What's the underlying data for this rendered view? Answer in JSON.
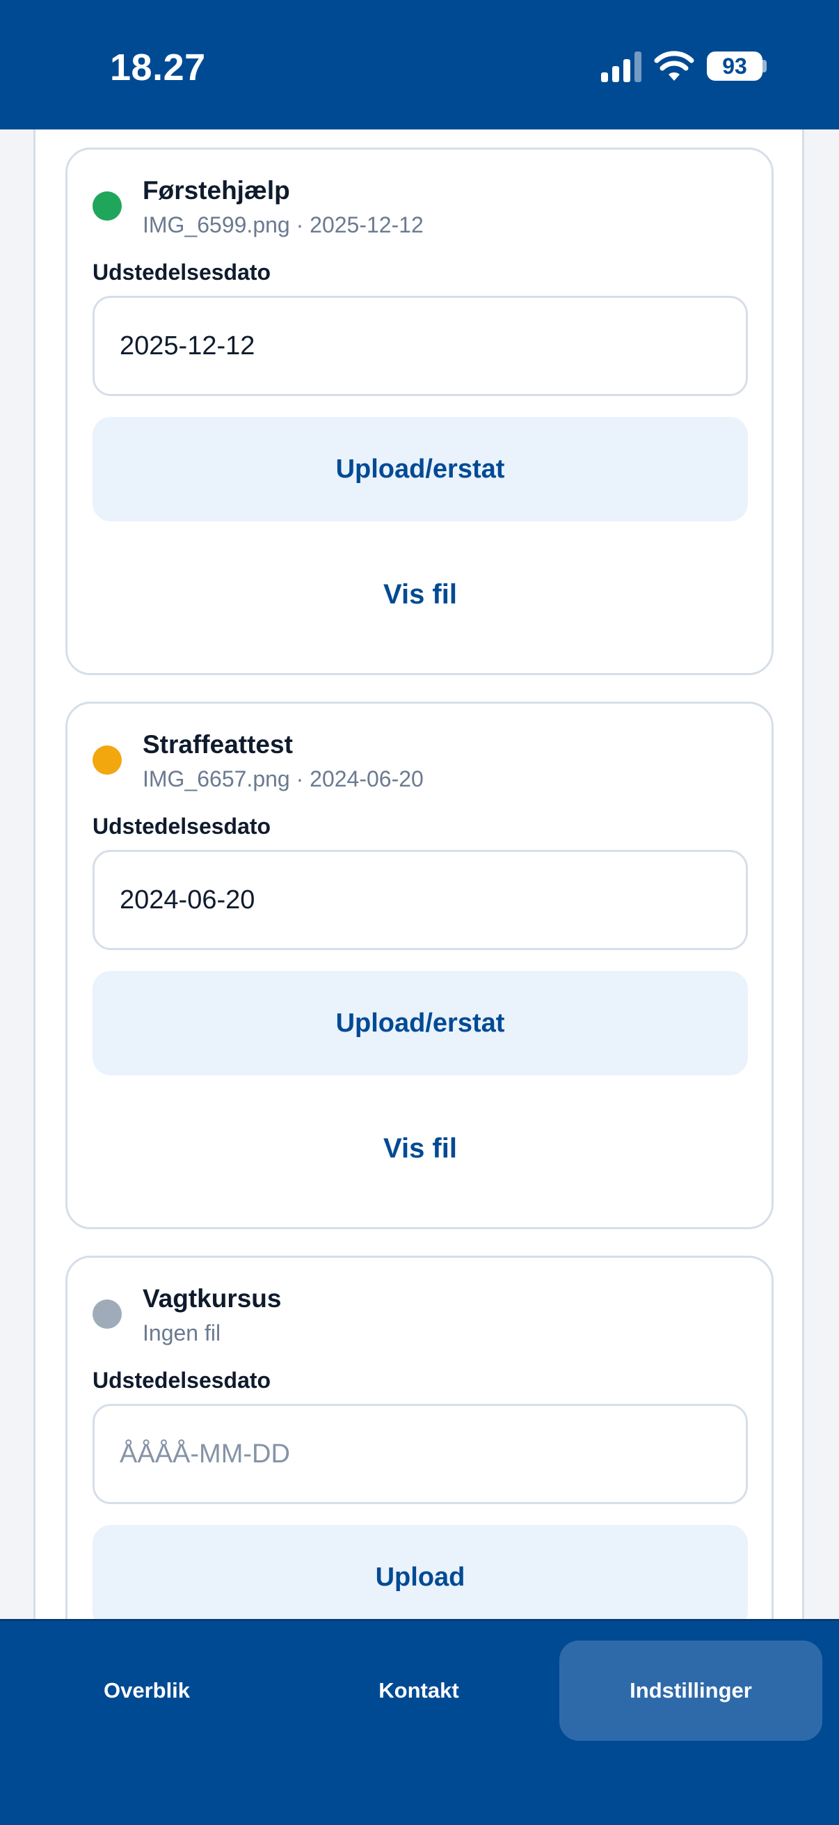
{
  "status_bar": {
    "time": "18.27",
    "battery": "93",
    "icons": [
      "signal-icon",
      "wifi-icon",
      "battery-icon"
    ]
  },
  "documents": [
    {
      "title": "Førstehjælp",
      "meta": "IMG_6599.png · 2025-12-12",
      "status_color": "#1FA65A",
      "date_label": "Udstedelsesdato",
      "date_value": "2025-12-12",
      "date_placeholder": "ÅÅÅÅ-MM-DD",
      "upload_label": "Upload/erstat",
      "view_label": "Vis fil"
    },
    {
      "title": "Straffeattest",
      "meta": "IMG_6657.png · 2024-06-20",
      "status_color": "#F2A70F",
      "date_label": "Udstedelsesdato",
      "date_value": "2024-06-20",
      "date_placeholder": "ÅÅÅÅ-MM-DD",
      "upload_label": "Upload/erstat",
      "view_label": "Vis fil"
    },
    {
      "title": "Vagtkursus",
      "meta": "Ingen fil",
      "status_color": "#A0ABBA",
      "date_label": "Udstedelsesdato",
      "date_value": "",
      "date_placeholder": "ÅÅÅÅ-MM-DD",
      "upload_label": "Upload"
    }
  ],
  "nav": {
    "items": [
      {
        "label": "Overblik",
        "active": false
      },
      {
        "label": "Kontakt",
        "active": false
      },
      {
        "label": "Indstillinger",
        "active": true
      }
    ]
  },
  "colors": {
    "brand": "#004A93",
    "button_bg": "#EAF2FC",
    "border": "#D6DEE9",
    "active_nav": "#2E6AAA"
  }
}
